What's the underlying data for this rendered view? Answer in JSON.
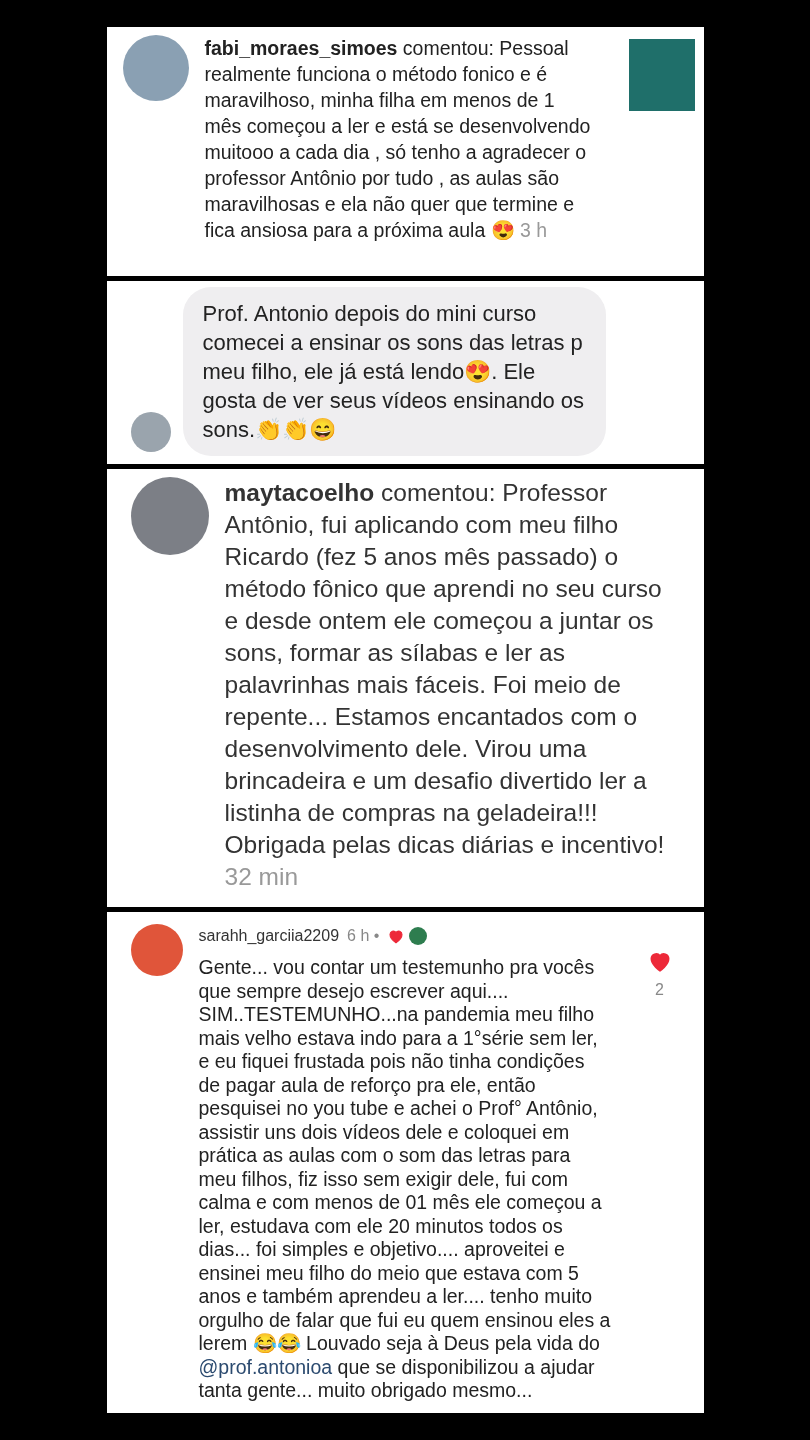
{
  "comments": [
    {
      "kind": "post",
      "text": "**fabi_moraes_simoes** comentou: Pessoal realmente funciona o método fonico e é maravilhoso,  minha filha em menos de 1 mês começou a ler e está se desenvolvendo muitooo a cada dia , só tenho a agradecer o professor Antônio por tudo , as aulas são maravilhosas e ela não quer que termine e fica ansiosa para a próxima aula 😍",
      "time": "3 h"
    },
    {
      "kind": "bubble",
      "text": "Prof. Antonio depois do mini curso comecei a ensinar os sons das letras p meu filho, ele já está lendo😍. Ele gosta de ver seus vídeos ensinando os sons.👏👏😄"
    },
    {
      "kind": "large",
      "text": "**maytacoelho** comentou: Professor Antônio, fui aplicando com meu filho Ricardo (fez 5 anos mês passado) o método fônico que aprendi no seu curso e desde ontem ele começou a juntar os sons, formar as sílabas e ler as palavrinhas mais fáceis. Foi meio de repente... Estamos encantados com o desenvolvimento dele. Virou uma brincadeira e um desafio divertido ler a listinha de compras na geladeira!!! Obrigada pelas dicas diárias e incentivo!",
      "time": "32 min"
    },
    {
      "kind": "thread",
      "username": "sarahh_garciia2209",
      "time": "6 h •",
      "liked_by_creator": true,
      "liked": true,
      "likes": "2",
      "text_before": "Gente... vou contar um testemunho pra vocês que sempre desejo escrever aqui.... SIM..TESTEMUNHO...na pandemia meu filho mais velho estava indo para a 1°série sem ler, e eu fiquei frustada pois não tinha condições de pagar aula de reforço pra ele, então pesquisei no you tube e achei o Prof° Antônio, assistir uns dois vídeos dele e coloquei em prática as aulas com o som das letras para meu filhos, fiz isso sem exigir dele, fui com calma e com menos de 01 mês ele começou a ler, estudava com ele 20 minutos todos os dias... foi simples e objetivo.... aproveitei e ensinei meu filho do meio que estava com 5 anos e também aprendeu a ler.... tenho muito orgulho de falar que fui eu quem ensinou eles a lerem 😂😂 Louvado seja à Deus  pela vida do ",
      "mention": "@prof.antonioa",
      "text_after": " que se disponibilizou a ajudar tanta gente... muito obrigado mesmo..."
    }
  ]
}
